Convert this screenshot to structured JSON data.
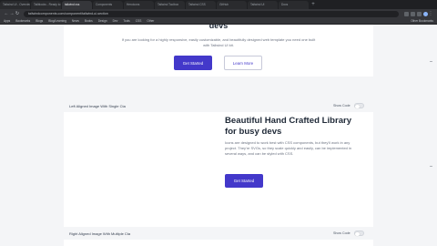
{
  "browser": {
    "tabs": [
      {
        "label": "Tailwind UI - Overview"
      },
      {
        "label": "Tailblocks - Ready to use"
      },
      {
        "label": "tailwind css"
      },
      {
        "label": "Components"
      },
      {
        "label": "Heroicons"
      },
      {
        "label": "Tailwind Toolbox"
      },
      {
        "label": "Tailwind CSS"
      },
      {
        "label": "GitHub"
      },
      {
        "label": "Tailwind UI"
      },
      {
        "label": "Docs"
      }
    ],
    "url": "tailwindcomponents.com/component/tailwind-ui-section",
    "bookmarks": [
      "Apps",
      "Bookmarks",
      "Blogs",
      "Blog/Learning",
      "News",
      "Books",
      "Design",
      "Dev",
      "Tools",
      "CSS",
      "Other"
    ],
    "other_bookmarks": "Other Bookmarks"
  },
  "hero": {
    "title_tail": "devs",
    "text": "If you are looking for a highly responsive, easily customizable, and beautifully designed web template you need one built with Tailwind UI kit.",
    "primary_button": "Get Started",
    "secondary_button": "Learn More"
  },
  "section2": {
    "label": "Left Aligned Image With Single Cta",
    "toggle_label": "Show Code",
    "title": "Beautiful Hand Crafted Library for busy devs",
    "text": "Icons are designed to work best with CSS components, but they'll work in any project. They're SVGs, so they scale quickly and easily, can be implemented in several ways, and can be styled with CSS.",
    "button": "Get Started"
  },
  "section3": {
    "label": "Right Aligned Image With Multiple Cta",
    "toggle_label": "Show Code"
  }
}
